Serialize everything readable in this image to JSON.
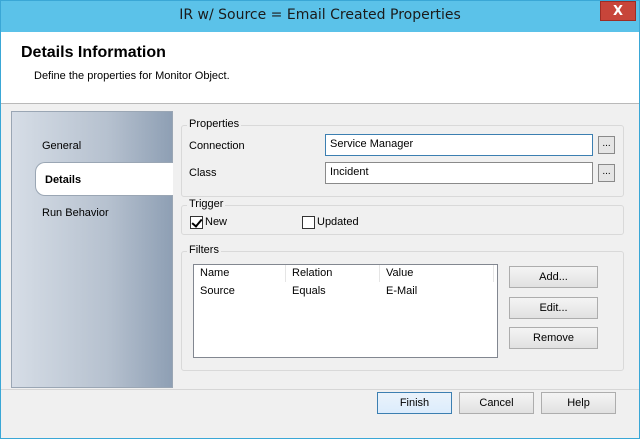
{
  "window": {
    "title": "IR w/ Source = Email Created Properties",
    "close_label": "X"
  },
  "header": {
    "title": "Details Information",
    "subtitle": "Define the properties for Monitor Object."
  },
  "sidebar": {
    "items": [
      {
        "label": "General",
        "active": false
      },
      {
        "label": "Details",
        "active": true
      },
      {
        "label": "Run Behavior",
        "active": false
      }
    ]
  },
  "properties": {
    "group_label": "Properties",
    "connection_label": "Connection",
    "connection_value": "Service Manager",
    "class_label": "Class",
    "class_value": "Incident",
    "browse_label": "..."
  },
  "trigger": {
    "group_label": "Trigger",
    "new_label": "New",
    "new_checked": true,
    "updated_label": "Updated",
    "updated_checked": false
  },
  "filters": {
    "group_label": "Filters",
    "columns": [
      "Name",
      "Relation",
      "Value"
    ],
    "rows": [
      {
        "name": "Source",
        "relation": "Equals",
        "value": "E-Mail"
      }
    ],
    "add_label": "Add...",
    "edit_label": "Edit...",
    "remove_label": "Remove"
  },
  "footer": {
    "finish_label": "Finish",
    "cancel_label": "Cancel",
    "help_label": "Help"
  }
}
